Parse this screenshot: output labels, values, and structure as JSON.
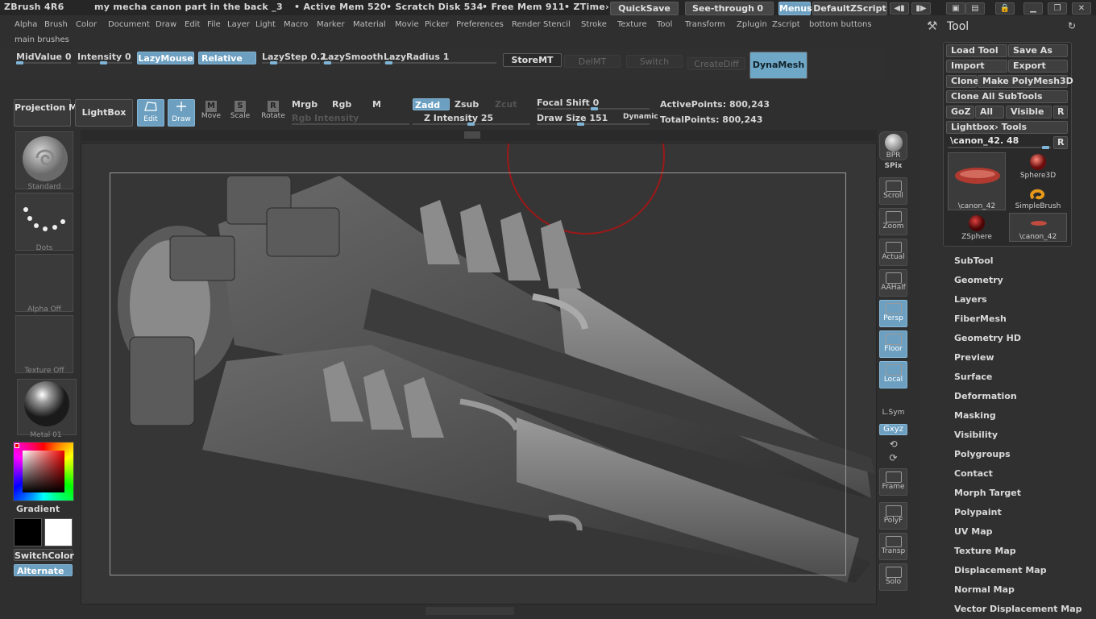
{
  "titlebar": {
    "app": "ZBrush 4R6",
    "doc": "my mecha canon part in the back _3",
    "active_mem": "• Active Mem 520",
    "scratch": "• Scratch Disk 534",
    "free_mem": "• Free Mem 911",
    "ztime": "• ZTime›",
    "quicksave": "QuickSave",
    "see_through": "See-through",
    "see_through_value": "0",
    "menus": "Menus",
    "default_zscript": "DefaultZScript"
  },
  "menus": [
    "Alpha",
    "Brush",
    "Color",
    "Document",
    "Draw",
    "Edit",
    "File",
    "Layer",
    "Light",
    "Macro",
    "Marker",
    "Material",
    "Movie",
    "Picker",
    "Preferences",
    "Render",
    "Stencil",
    "Stroke",
    "Texture",
    "Tool",
    "Transform",
    "Zplugin",
    "Zscript",
    "bottom buttons"
  ],
  "menus_row2": "main brushes",
  "toolbar1": {
    "midvalue": "MidValue 0",
    "intensity": "Intensity 0",
    "lazymouse": "LazyMouse",
    "relative": "Relative",
    "lazystep": "LazyStep 0.2",
    "lazysmooth": "LazySmooth",
    "lazyradius": "LazyRadius 1",
    "storemt": "StoreMT",
    "delmt": "DelMT",
    "switch": "Switch",
    "creatediff": "CreateDiff",
    "dynamesh": "DynaMesh"
  },
  "toolbar2": {
    "projection_master": "Projection Master",
    "lightbox": "LightBox",
    "edit": "Edit",
    "draw": "Draw",
    "move": "Move",
    "scale": "Scale",
    "rotate": "Rotate",
    "mrgb": "Mrgb",
    "rgb": "Rgb",
    "m": "M",
    "zadd": "Zadd",
    "zsub": "Zsub",
    "zcut": "Zcut",
    "rgb_intensity": "Rgb Intensity",
    "z_intensity": "Z Intensity 25",
    "focal_shift": "Focal Shift 0",
    "draw_size": "Draw Size 151",
    "dynamic": "Dynamic",
    "active_points": "ActivePoints: 800,243",
    "total_points": "TotalPoints: 800,243"
  },
  "left_shelf": {
    "brush": "Standard",
    "stroke": "Dots",
    "alpha": "Alpha Off",
    "texture": "Texture Off",
    "material": "Metal 01",
    "gradient": "Gradient",
    "switchcolor": "SwitchColor",
    "alternate": "Alternate"
  },
  "right_dock": [
    "BPR",
    "SPix",
    "Scroll",
    "Zoom",
    "Actual",
    "AAHalf",
    "Persp",
    "Floor",
    "Local",
    "L.Sym",
    "Gxyz",
    "Frame",
    "PolyF",
    "Transp",
    "Solo"
  ],
  "tool_panel": {
    "title": "Tool",
    "load_tool": "Load Tool",
    "save_as": "Save As",
    "import": "Import",
    "export": "Export",
    "clone": "Clone",
    "make_polymesh": "Make PolyMesh3D",
    "clone_all": "Clone  All SubTools",
    "goz": "GoZ",
    "all": "All",
    "visible": "Visible",
    "r": "R",
    "lightbox_tools": "Lightbox› Tools",
    "current_tool": "\\canon_42. 48",
    "thumbs": [
      "\\canon_42",
      "Sphere3D",
      "SimpleBrush",
      "ZSphere",
      "\\canon_42"
    ],
    "subpalettes": [
      "SubTool",
      "Geometry",
      "Layers",
      "FiberMesh",
      "Geometry HD",
      "Preview",
      "Surface",
      "Deformation",
      "Masking",
      "Visibility",
      "Polygroups",
      "Contact",
      "Morph Target",
      "Polypaint",
      "UV Map",
      "Texture Map",
      "Displacement Map",
      "Normal Map",
      "Vector Displacement Map"
    ]
  }
}
